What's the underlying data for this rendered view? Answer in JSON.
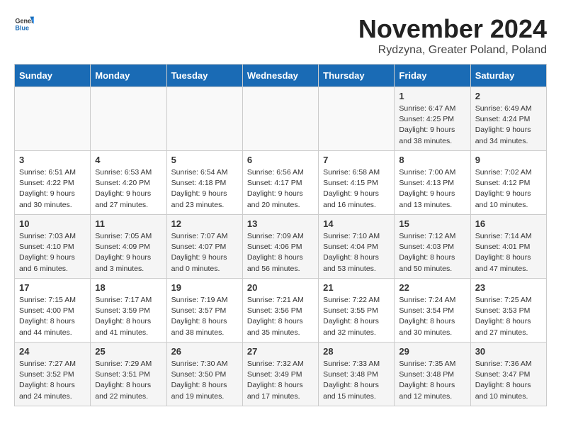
{
  "header": {
    "logo_general": "General",
    "logo_blue": "Blue",
    "title": "November 2024",
    "subtitle": "Rydzyna, Greater Poland, Poland"
  },
  "weekdays": [
    "Sunday",
    "Monday",
    "Tuesday",
    "Wednesday",
    "Thursday",
    "Friday",
    "Saturday"
  ],
  "weeks": [
    [
      {
        "day": "",
        "info": ""
      },
      {
        "day": "",
        "info": ""
      },
      {
        "day": "",
        "info": ""
      },
      {
        "day": "",
        "info": ""
      },
      {
        "day": "",
        "info": ""
      },
      {
        "day": "1",
        "info": "Sunrise: 6:47 AM\nSunset: 4:25 PM\nDaylight: 9 hours\nand 38 minutes."
      },
      {
        "day": "2",
        "info": "Sunrise: 6:49 AM\nSunset: 4:24 PM\nDaylight: 9 hours\nand 34 minutes."
      }
    ],
    [
      {
        "day": "3",
        "info": "Sunrise: 6:51 AM\nSunset: 4:22 PM\nDaylight: 9 hours\nand 30 minutes."
      },
      {
        "day": "4",
        "info": "Sunrise: 6:53 AM\nSunset: 4:20 PM\nDaylight: 9 hours\nand 27 minutes."
      },
      {
        "day": "5",
        "info": "Sunrise: 6:54 AM\nSunset: 4:18 PM\nDaylight: 9 hours\nand 23 minutes."
      },
      {
        "day": "6",
        "info": "Sunrise: 6:56 AM\nSunset: 4:17 PM\nDaylight: 9 hours\nand 20 minutes."
      },
      {
        "day": "7",
        "info": "Sunrise: 6:58 AM\nSunset: 4:15 PM\nDaylight: 9 hours\nand 16 minutes."
      },
      {
        "day": "8",
        "info": "Sunrise: 7:00 AM\nSunset: 4:13 PM\nDaylight: 9 hours\nand 13 minutes."
      },
      {
        "day": "9",
        "info": "Sunrise: 7:02 AM\nSunset: 4:12 PM\nDaylight: 9 hours\nand 10 minutes."
      }
    ],
    [
      {
        "day": "10",
        "info": "Sunrise: 7:03 AM\nSunset: 4:10 PM\nDaylight: 9 hours\nand 6 minutes."
      },
      {
        "day": "11",
        "info": "Sunrise: 7:05 AM\nSunset: 4:09 PM\nDaylight: 9 hours\nand 3 minutes."
      },
      {
        "day": "12",
        "info": "Sunrise: 7:07 AM\nSunset: 4:07 PM\nDaylight: 9 hours\nand 0 minutes."
      },
      {
        "day": "13",
        "info": "Sunrise: 7:09 AM\nSunset: 4:06 PM\nDaylight: 8 hours\nand 56 minutes."
      },
      {
        "day": "14",
        "info": "Sunrise: 7:10 AM\nSunset: 4:04 PM\nDaylight: 8 hours\nand 53 minutes."
      },
      {
        "day": "15",
        "info": "Sunrise: 7:12 AM\nSunset: 4:03 PM\nDaylight: 8 hours\nand 50 minutes."
      },
      {
        "day": "16",
        "info": "Sunrise: 7:14 AM\nSunset: 4:01 PM\nDaylight: 8 hours\nand 47 minutes."
      }
    ],
    [
      {
        "day": "17",
        "info": "Sunrise: 7:15 AM\nSunset: 4:00 PM\nDaylight: 8 hours\nand 44 minutes."
      },
      {
        "day": "18",
        "info": "Sunrise: 7:17 AM\nSunset: 3:59 PM\nDaylight: 8 hours\nand 41 minutes."
      },
      {
        "day": "19",
        "info": "Sunrise: 7:19 AM\nSunset: 3:57 PM\nDaylight: 8 hours\nand 38 minutes."
      },
      {
        "day": "20",
        "info": "Sunrise: 7:21 AM\nSunset: 3:56 PM\nDaylight: 8 hours\nand 35 minutes."
      },
      {
        "day": "21",
        "info": "Sunrise: 7:22 AM\nSunset: 3:55 PM\nDaylight: 8 hours\nand 32 minutes."
      },
      {
        "day": "22",
        "info": "Sunrise: 7:24 AM\nSunset: 3:54 PM\nDaylight: 8 hours\nand 30 minutes."
      },
      {
        "day": "23",
        "info": "Sunrise: 7:25 AM\nSunset: 3:53 PM\nDaylight: 8 hours\nand 27 minutes."
      }
    ],
    [
      {
        "day": "24",
        "info": "Sunrise: 7:27 AM\nSunset: 3:52 PM\nDaylight: 8 hours\nand 24 minutes."
      },
      {
        "day": "25",
        "info": "Sunrise: 7:29 AM\nSunset: 3:51 PM\nDaylight: 8 hours\nand 22 minutes."
      },
      {
        "day": "26",
        "info": "Sunrise: 7:30 AM\nSunset: 3:50 PM\nDaylight: 8 hours\nand 19 minutes."
      },
      {
        "day": "27",
        "info": "Sunrise: 7:32 AM\nSunset: 3:49 PM\nDaylight: 8 hours\nand 17 minutes."
      },
      {
        "day": "28",
        "info": "Sunrise: 7:33 AM\nSunset: 3:48 PM\nDaylight: 8 hours\nand 15 minutes."
      },
      {
        "day": "29",
        "info": "Sunrise: 7:35 AM\nSunset: 3:48 PM\nDaylight: 8 hours\nand 12 minutes."
      },
      {
        "day": "30",
        "info": "Sunrise: 7:36 AM\nSunset: 3:47 PM\nDaylight: 8 hours\nand 10 minutes."
      }
    ]
  ]
}
